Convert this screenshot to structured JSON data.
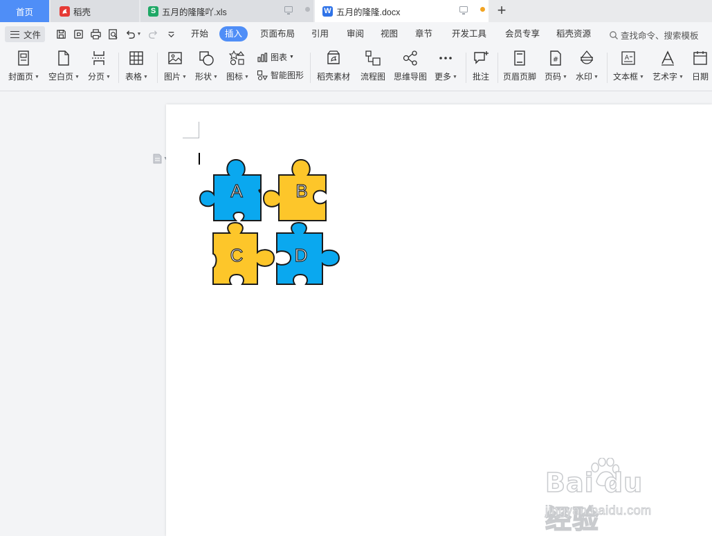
{
  "tabs": {
    "home": "首页",
    "wengke": "稻壳",
    "xls": "五月的隆隆吖.xls",
    "docx": "五月的隆隆.docx",
    "xls_icon": "S",
    "docx_icon": "W",
    "add": "+"
  },
  "menu": {
    "file": "文件",
    "tabs": [
      "开始",
      "插入",
      "页面布局",
      "引用",
      "审阅",
      "视图",
      "章节",
      "开发工具",
      "会员专享",
      "稻壳资源"
    ],
    "active_tab": "插入",
    "search_placeholder": "查找命令、搜索模板"
  },
  "ribbon": {
    "cover": "封面页",
    "blank": "空白页",
    "pagebreak": "分页",
    "table": "表格",
    "picture": "图片",
    "shape": "形状",
    "icon": "图标",
    "chart": "图表",
    "smartart": "智能图形",
    "material": "稻壳素材",
    "flowchart": "流程图",
    "mindmap": "思维导图",
    "more": "更多",
    "comment": "批注",
    "header_footer": "页眉页脚",
    "page_number": "页码",
    "watermark": "水印",
    "textbox": "文本框",
    "wordart": "艺术字",
    "date": "日期"
  },
  "document": {
    "puzzle_labels": [
      "A",
      "B",
      "C",
      "D"
    ],
    "colors": {
      "blue": "#0aa8ef",
      "yellow": "#fdc62a",
      "outline": "#1a1a1a",
      "accent": "#4f8ef7"
    }
  },
  "watermark": {
    "logo": "Bai du 经验",
    "url": "jingyan.baidu.com"
  }
}
